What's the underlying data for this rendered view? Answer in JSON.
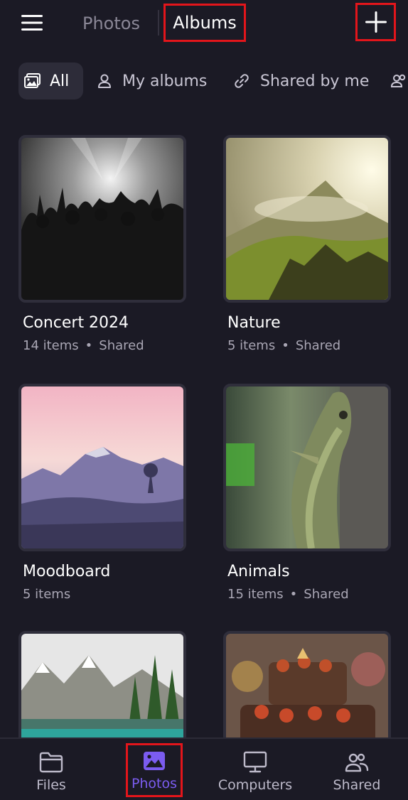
{
  "header": {
    "menu_icon": "hamburger-menu-icon",
    "tab_photos": "Photos",
    "tab_albums": "Albums",
    "add_icon": "plus-icon"
  },
  "filters": [
    {
      "label": "All",
      "icon": "image-icon",
      "selected": true
    },
    {
      "label": "My albums",
      "icon": "person-icon",
      "selected": false
    },
    {
      "label": "Shared by me",
      "icon": "link-icon",
      "selected": false
    },
    {
      "label": "",
      "icon": "people-icon",
      "selected": false
    }
  ],
  "albums": [
    {
      "title": "Concert 2024",
      "count": "14 items",
      "status": "Shared",
      "thumb": "concert-crowd"
    },
    {
      "title": "Nature",
      "count": "5 items",
      "status": "Shared",
      "thumb": "foggy-mountain"
    },
    {
      "title": "Moodboard",
      "count": "5 items",
      "status": "",
      "thumb": "pink-mountains"
    },
    {
      "title": "Animals",
      "count": "15 items",
      "status": "Shared",
      "thumb": "iguana"
    },
    {
      "title": "",
      "count": "",
      "status": "",
      "thumb": "alpine-lake"
    },
    {
      "title": "",
      "count": "",
      "status": "",
      "thumb": "chocolate-cake"
    }
  ],
  "bottom_nav": [
    {
      "label": "Files",
      "icon": "folder-icon",
      "active": false
    },
    {
      "label": "Photos",
      "icon": "photo-icon",
      "active": true
    },
    {
      "label": "Computers",
      "icon": "monitor-icon",
      "active": false
    },
    {
      "label": "Shared",
      "icon": "people-icon",
      "active": false
    }
  ],
  "colors": {
    "background": "#1b1a25",
    "accent": "#7b5cf0",
    "highlight_box": "#e3151b"
  }
}
